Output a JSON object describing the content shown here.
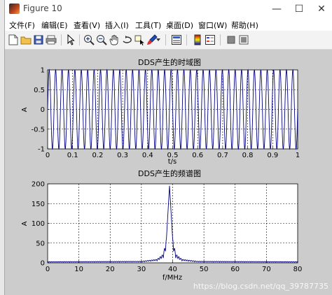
{
  "window": {
    "title": "Figure 10",
    "controls": {
      "minimize": "—",
      "maximize": "☐",
      "close": "✕"
    }
  },
  "menu": [
    {
      "label": "文件(F)"
    },
    {
      "label": "编辑(E)"
    },
    {
      "label": "查看(V)"
    },
    {
      "label": "插入(I)"
    },
    {
      "label": "工具(T)"
    },
    {
      "label": "桌面(D)"
    },
    {
      "label": "窗口(W)"
    },
    {
      "label": "帮助(H)"
    }
  ],
  "toolbar": [
    "new-figure-icon",
    "open-file-icon",
    "save-icon",
    "print-icon",
    "edit-plot-arrow-icon",
    "zoom-in-icon",
    "zoom-out-icon",
    "pan-hand-icon",
    "rotate-3d-icon",
    "data-cursor-icon",
    "brush-icon",
    "link-plot-icon",
    "colorbar-icon",
    "legend-icon",
    "hide-plot-tools-icon",
    "show-plot-tools-icon"
  ],
  "colors": {
    "figure_bg": "#cccccc",
    "axes_bg": "#ffffff",
    "line": "#00007f",
    "grid": "#000000"
  },
  "chart_data": [
    {
      "type": "line",
      "title": "DDS产生的时域图",
      "xlabel": "t/s",
      "ylabel": "A",
      "xlim": [
        0,
        1
      ],
      "ylim": [
        -1,
        1
      ],
      "xticks": [
        "0",
        "0.1",
        "0.2",
        "0.3",
        "0.4",
        "0.5",
        "0.6",
        "0.7",
        "0.8",
        "0.9",
        "1"
      ],
      "yticks": [
        "1",
        "0.5",
        "0",
        "-0.5",
        "-1"
      ],
      "grid": true,
      "series": [
        {
          "function": "sin",
          "amplitude": 1,
          "cycles_over_x_range": 39,
          "start_x": 0,
          "end_x": 1
        }
      ]
    },
    {
      "type": "line",
      "title": "DDS产生的频谱图",
      "xlabel": "f/MHz",
      "ylabel": "A",
      "xlim": [
        0,
        80
      ],
      "ylim": [
        0,
        200
      ],
      "xticks": [
        "0",
        "10",
        "20",
        "30",
        "40",
        "50",
        "60",
        "70",
        "80"
      ],
      "yticks": [
        "200",
        "150",
        "100",
        "50",
        "0"
      ],
      "grid": true,
      "series": [
        {
          "peak_x": 39,
          "peak_y": 195,
          "sidelobe_level": 3,
          "description_points": [
            [
              0,
              3
            ],
            [
              30,
              4
            ],
            [
              35,
              9
            ],
            [
              37,
              22
            ],
            [
              38,
              60
            ],
            [
              39,
              195
            ],
            [
              40,
              60
            ],
            [
              41,
              22
            ],
            [
              43,
              9
            ],
            [
              48,
              4
            ],
            [
              80,
              3
            ]
          ]
        }
      ]
    }
  ],
  "watermark": "https://blog.csdn.net/qq_39787735"
}
